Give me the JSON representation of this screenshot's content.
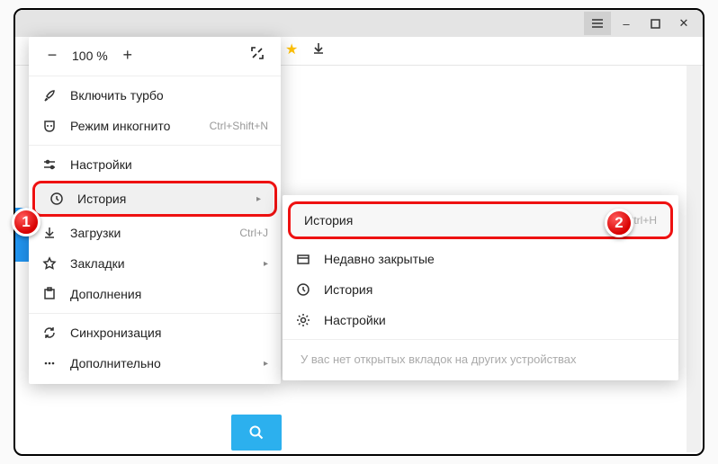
{
  "window": {
    "hamburger": "menu",
    "min": "–",
    "max": "□",
    "close": "✕"
  },
  "zoom": {
    "minus": "−",
    "value": "100 %",
    "plus": "+"
  },
  "menu": {
    "turbo": "Включить турбо",
    "incognito": "Режим инкогнито",
    "incognito_hk": "Ctrl+Shift+N",
    "settings": "Настройки",
    "history": "История",
    "downloads": "Загрузки",
    "downloads_hk": "Ctrl+J",
    "bookmarks": "Закладки",
    "addons": "Дополнения",
    "sync": "Синхронизация",
    "more": "Дополнительно"
  },
  "submenu": {
    "history_head": "История",
    "history_hk": "Ctrl+H",
    "recent": "Недавно закрытые",
    "history": "История",
    "settings": "Настройки",
    "no_tabs": "У вас нет открытых вкладок на других устройствах"
  },
  "badges": {
    "one": "1",
    "two": "2"
  }
}
